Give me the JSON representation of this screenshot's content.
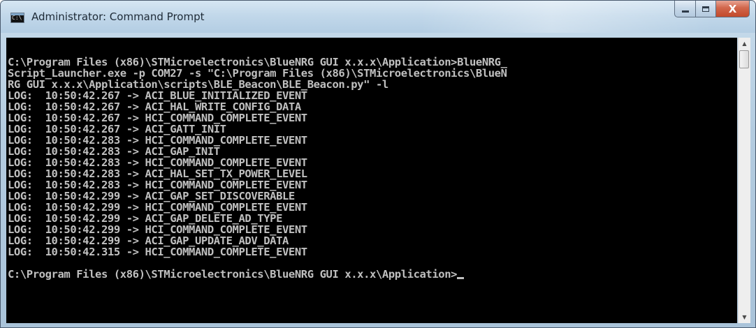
{
  "window": {
    "title": "Administrator: Command Prompt",
    "icon": "command-prompt-icon",
    "icon_text": "C:\\"
  },
  "caption": {
    "minimize_icon": "minimize-icon",
    "maximize_icon": "maximize-icon",
    "close_glyph": "X"
  },
  "console": {
    "lines": [
      "",
      "C:\\Program Files (x86)\\STMicroelectronics\\BlueNRG GUI x.x.x\\Application>BlueNRG_",
      "Script_Launcher.exe -p COM27 -s \"C:\\Program Files (x86)\\STMicroelectronics\\BlueN",
      "RG GUI x.x.x\\Application\\scripts\\BLE_Beacon\\BLE_Beacon.py\" -l",
      "LOG:  10:50:42.267 -> ACI_BLUE_INITIALIZED_EVENT",
      "LOG:  10:50:42.267 -> ACI_HAL_WRITE_CONFIG_DATA",
      "LOG:  10:50:42.267 -> HCI_COMMAND_COMPLETE_EVENT",
      "LOG:  10:50:42.267 -> ACI_GATT_INIT",
      "LOG:  10:50:42.283 -> HCI_COMMAND_COMPLETE_EVENT",
      "LOG:  10:50:42.283 -> ACI_GAP_INIT",
      "LOG:  10:50:42.283 -> HCI_COMMAND_COMPLETE_EVENT",
      "LOG:  10:50:42.283 -> ACI_HAL_SET_TX_POWER_LEVEL",
      "LOG:  10:50:42.283 -> HCI_COMMAND_COMPLETE_EVENT",
      "LOG:  10:50:42.299 -> ACI_GAP_SET_DISCOVERABLE",
      "LOG:  10:50:42.299 -> HCI_COMMAND_COMPLETE_EVENT",
      "LOG:  10:50:42.299 -> ACI_GAP_DELETE_AD_TYPE",
      "LOG:  10:50:42.299 -> HCI_COMMAND_COMPLETE_EVENT",
      "LOG:  10:50:42.299 -> ACI_GAP_UPDATE_ADV_DATA",
      "LOG:  10:50:42.315 -> HCI_COMMAND_COMPLETE_EVENT",
      "",
      "C:\\Program Files (x86)\\STMicroelectronics\\BlueNRG GUI x.x.x\\Application>"
    ]
  },
  "scrollbar": {
    "up_icon": "scroll-up-arrow-icon",
    "down_icon": "scroll-down-arrow-icon"
  }
}
